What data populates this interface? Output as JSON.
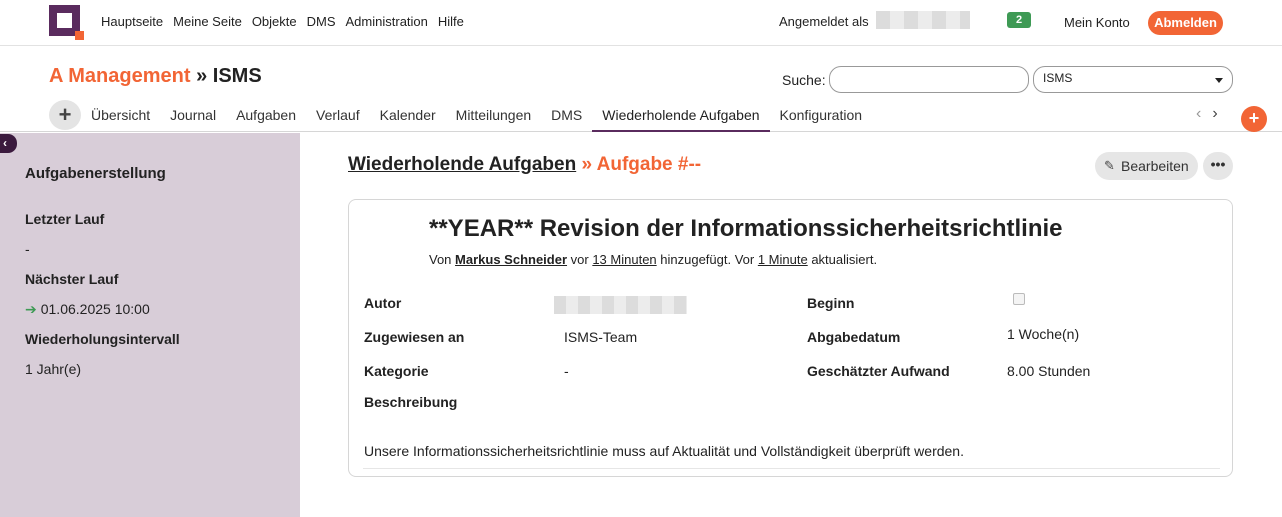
{
  "topbar": {
    "nav": [
      "Hauptseite",
      "Meine Seite",
      "Objekte",
      "DMS",
      "Administration",
      "Hilfe"
    ],
    "logged_in_label": "Angemeldet als",
    "notification_count": "2",
    "my_account": "Mein Konto",
    "logout": "Abmelden"
  },
  "header": {
    "parent_project": "A Management",
    "separator": " » ",
    "project": "ISMS",
    "search_label": "Suche:",
    "project_select_value": "ISMS"
  },
  "tabs": {
    "plus": "+",
    "items": [
      "Übersicht",
      "Journal",
      "Aufgaben",
      "Verlauf",
      "Kalender",
      "Mitteilungen",
      "DMS",
      "Wiederholende Aufgaben",
      "Konfiguration"
    ],
    "active_index": 7,
    "prev_arrow": "‹",
    "next_arrow": "›",
    "add_button": "+"
  },
  "sidebar": {
    "toggle": "‹",
    "title": "Aufgabenerstellung",
    "last_run_label": "Letzter Lauf",
    "last_run_value": "-",
    "next_run_label": "Nächster Lauf",
    "next_run_value": "01.06.2025 10:00",
    "interval_label": "Wiederholungsintervall",
    "interval_value": "1 Jahr(e)"
  },
  "main": {
    "breadcrumb_link": "Wiederholende Aufgaben",
    "breadcrumb_current": " » Aufgabe #--",
    "edit_label": "Bearbeiten",
    "more_label": "•••",
    "task": {
      "title": "**YEAR** Revision der Informationssicherheitsrichtlinie",
      "sub_prefix": "Von ",
      "author_link": "Markus Schneider",
      "sub_mid1": " vor ",
      "added_ago": "13 Minuten",
      "sub_mid2": " hinzugefügt. Vor ",
      "updated_ago": "1 Minute",
      "sub_suffix": " aktualisiert.",
      "fields": {
        "author_label": "Autor",
        "assigned_label": "Zugewiesen an",
        "assigned_value": "ISMS-Team",
        "category_label": "Kategorie",
        "category_value": "-",
        "start_label": "Beginn",
        "due_label": "Abgabedatum",
        "due_value": "1 Woche(n)",
        "effort_label": "Geschätzter Aufwand",
        "effort_value": "8.00 Stunden",
        "description_label": "Beschreibung",
        "description_text": "Unsere Informationssicherheitsrichtlinie muss auf Aktualität und Vollständigkeit überprüft werden."
      }
    }
  }
}
